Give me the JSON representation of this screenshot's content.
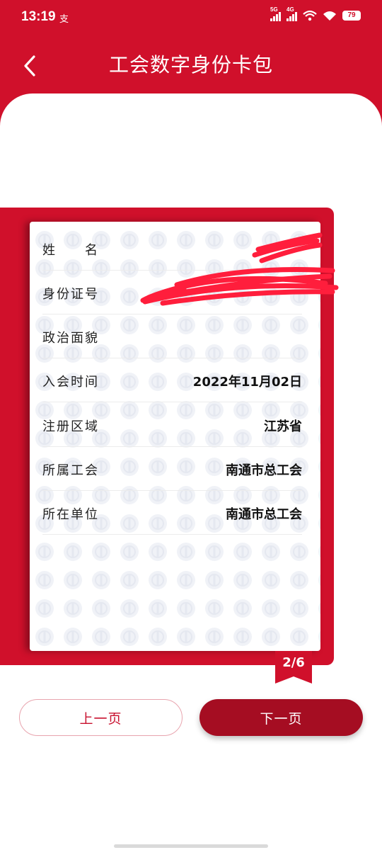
{
  "status_bar": {
    "time": "13:19",
    "app_indicator": "支",
    "signal_1_label": "5G",
    "signal_2_label": "4G",
    "battery": "79"
  },
  "header": {
    "title": "工会数字身份卡包",
    "back_icon": "chevron-left-icon"
  },
  "card": {
    "rows": [
      {
        "label": "姓　　名",
        "value": ""
      },
      {
        "label": "身份证号",
        "value": ""
      },
      {
        "label": "政治面貌",
        "value": ""
      },
      {
        "label": "入会时间",
        "value": "2022年11月02日"
      },
      {
        "label": "注册区域",
        "value": "江苏省"
      },
      {
        "label": "所属工会",
        "value": "南通市总工会"
      },
      {
        "label": "所在单位",
        "value": "南通市总工会"
      }
    ],
    "page_indicator": "2/6"
  },
  "buttons": {
    "prev_label": "上一页",
    "next_label": "下一页"
  },
  "colors": {
    "brand_red": "#d0102b",
    "dark_red": "#a50d22",
    "redaction": "#ff1e3c"
  }
}
